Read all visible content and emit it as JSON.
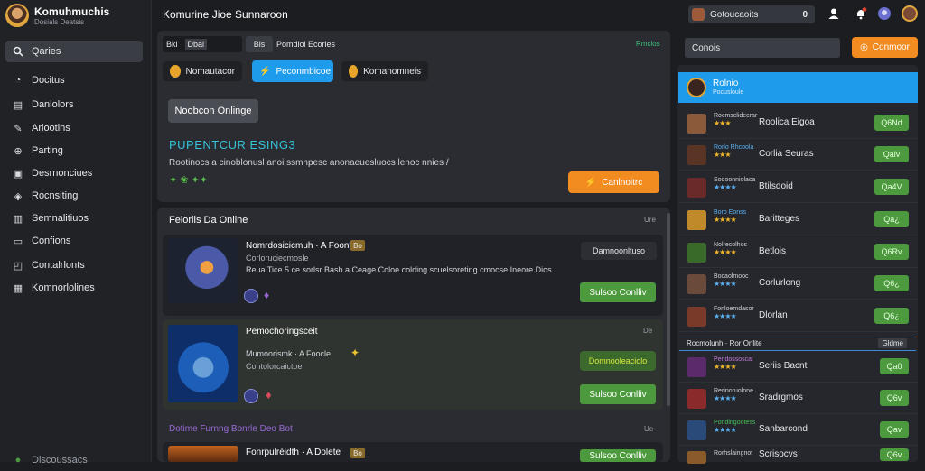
{
  "brand": {
    "name": "Komuhmuchis",
    "sub": "Dosials Deatsis"
  },
  "sidebar": {
    "search_label": "Qaries",
    "items": [
      {
        "label": "Docitus",
        "icon": "gauge-icon"
      },
      {
        "label": "Danlolors",
        "icon": "document-icon"
      },
      {
        "label": "Arlootins",
        "icon": "pencil-icon"
      },
      {
        "label": "Parting",
        "icon": "controller-icon"
      },
      {
        "label": "Desrnonciues",
        "icon": "calendar-icon"
      },
      {
        "label": "Rocnsiting",
        "icon": "diamond-icon"
      },
      {
        "label": "Semnalitiuos",
        "icon": "chart-icon"
      },
      {
        "label": "Confions",
        "icon": "monitor-icon"
      },
      {
        "label": "Contalrlonts",
        "icon": "box-icon"
      },
      {
        "label": "Komnorlolines",
        "icon": "grid-icon"
      }
    ],
    "footer_label": "Discoussacs"
  },
  "header": {
    "title": "Komurine Jioe Sunnaroon",
    "search_value": "Gotoucaoits",
    "search_count": "0"
  },
  "hero": {
    "tabs": [
      "Bki",
      "Dbai",
      "Bis"
    ],
    "breadcrumb": "Pomdlol Ecorles",
    "corner_link": "Rmclos",
    "pills": [
      "Nomautacor",
      "Peconmbicoe",
      "Komanomneis"
    ],
    "filter_button": "Noobcon Onlinge",
    "heading": "PUPENTCUR ESING3",
    "description": "Rootinocs a cinoblonusl anoi ssmnpesc anonaeuesluocs lenoc nnies /",
    "tags": "✦ ❀ ✦✦",
    "cta_label": "Canlnoitrc"
  },
  "list": {
    "title": "Feloriis Da Online",
    "corner": "Ure",
    "cards": [
      {
        "title": "Nomrdosicicmuh · A Foonte",
        "badge": "Bo",
        "sub": "Corloruciecmosle",
        "desc": "Reua Tice 5 ce sorlsr Basb a Ceage Coloe colding scuelsoreting cmocse Ineore Dios.",
        "side_label": "Damnoonltuso",
        "btn_label": "Sulsoo Conlliv"
      },
      {
        "title": "Pemochoringsceit",
        "badge": "",
        "sub": "Mumoorismk · A Foocle",
        "desc": "Contolorcaictoe",
        "side_label": "Domnooleaciolo",
        "btn_label": "Sulsoo Conlliv",
        "corner": "De"
      }
    ],
    "subsection_title": "Dotime Furnng Bonrle Deo Bot",
    "subsection_corner": "Ue",
    "third_card": {
      "title": "Fonrpulréidth · A Dolete",
      "badge": "Bo",
      "btn_label": "Sulsoo Conlliv"
    }
  },
  "right": {
    "search_placeholder": "Conois",
    "action_button": "Conmoor",
    "featured_label": "Rolnio",
    "featured_sub": "Pocusloule",
    "rows": [
      {
        "meta": "Rocmsclidecrar",
        "name": "Roolica Eigoa",
        "btn": "Q6Nd"
      },
      {
        "meta": "Rorlo Rhcoola",
        "name": "Corlia Seuras",
        "btn": "Qaiv"
      },
      {
        "meta": "Sodoonniolaca",
        "name": "Btilsdoid",
        "btn": "Qa4V"
      },
      {
        "meta": "Boro Eonss",
        "name": "Baritteges",
        "btn": "Qa¿"
      },
      {
        "meta": "Nolrecolhos",
        "name": "Betlois",
        "btn": "Q6Rv"
      },
      {
        "meta": "Bocaolmooc",
        "name": "Corlurlong",
        "btn": "Q6¿"
      },
      {
        "meta": "Fonloemdasor",
        "name": "Dlorlan",
        "btn": "Q6¿"
      }
    ],
    "divider_label": "Rocmolunh · Ror Onlite",
    "divider_btn": "Gldme",
    "rows2": [
      {
        "meta": "Pendossoscal",
        "name": "Seriis Bacnt",
        "btn": "Qa0"
      },
      {
        "meta": "Rerinoruolnne",
        "name": "Sradrgmos",
        "btn": "Q6v"
      },
      {
        "meta": "Pondingootess",
        "name": "Sanbarcond",
        "btn": "Qav"
      },
      {
        "meta": "Rorhslaingnot",
        "name": "Scrisocvs",
        "btn": "Q6v"
      }
    ]
  },
  "colors": {
    "accent_blue": "#1e9bea",
    "accent_orange": "#f28b20",
    "green": "#4c9a3d"
  }
}
